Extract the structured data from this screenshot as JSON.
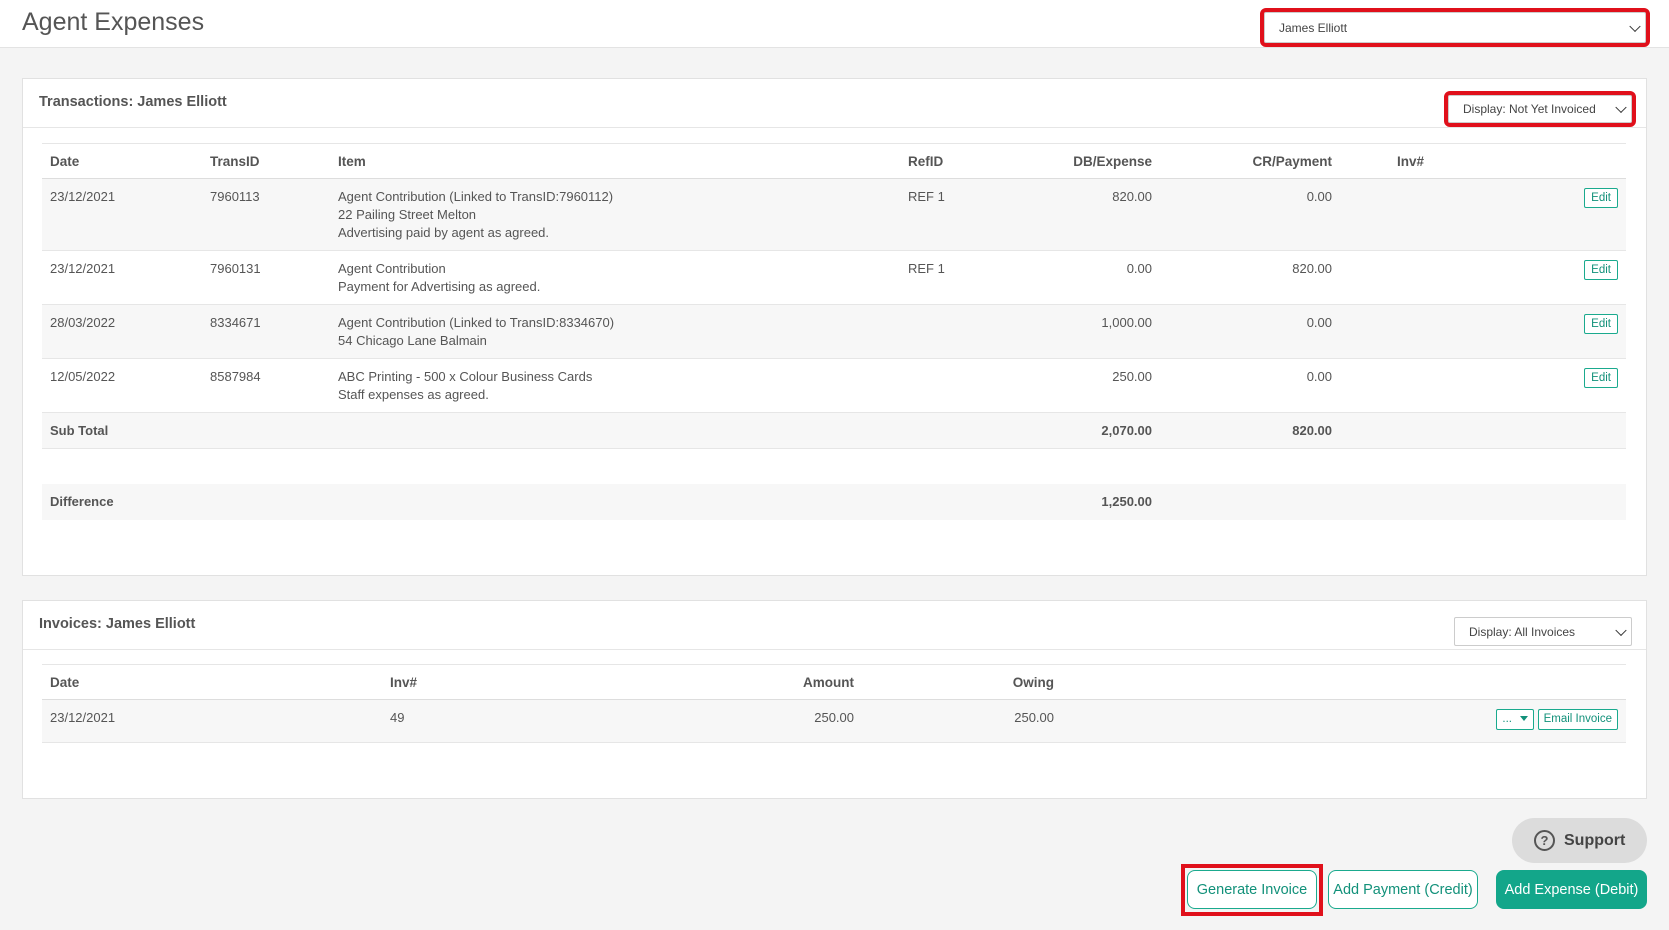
{
  "header": {
    "title": "Agent Expenses",
    "agent_select": "James Elliott"
  },
  "transactions": {
    "title": "Transactions: James Elliott",
    "filter": "Display: Not Yet Invoiced",
    "columns": [
      "Date",
      "TransID",
      "Item",
      "RefID",
      "DB/Expense",
      "CR/Payment",
      "Inv#"
    ],
    "rows": [
      {
        "date": "23/12/2021",
        "transid": "7960113",
        "item1": "Agent Contribution (Linked to TransID:7960112)",
        "item2": "22 Pailing Street Melton",
        "item3": "Advertising paid by agent as agreed.",
        "refid": "REF 1",
        "db": "820.00",
        "cr": "0.00",
        "edit": "Edit"
      },
      {
        "date": "23/12/2021",
        "transid": "7960131",
        "item1": "Agent Contribution",
        "item2": "Payment for Advertising as agreed.",
        "item3": "",
        "refid": "REF 1",
        "db": "0.00",
        "cr": "820.00",
        "edit": "Edit"
      },
      {
        "date": "28/03/2022",
        "transid": "8334671",
        "item1": "Agent Contribution (Linked to TransID:8334670)",
        "item2": "54 Chicago Lane Balmain",
        "item3": "",
        "refid": "",
        "db": "1,000.00",
        "cr": "0.00",
        "edit": "Edit"
      },
      {
        "date": "12/05/2022",
        "transid": "8587984",
        "item1": "ABC Printing - 500 x Colour Business Cards",
        "item2": "Staff expenses as agreed.",
        "item3": "",
        "refid": "",
        "db": "250.00",
        "cr": "0.00",
        "edit": "Edit"
      }
    ],
    "subtotal": {
      "label": "Sub Total",
      "db": "2,070.00",
      "cr": "820.00"
    },
    "difference": {
      "label": "Difference",
      "db": "1,250.00"
    }
  },
  "invoices": {
    "title": "Invoices: James Elliott",
    "filter": "Display: All Invoices",
    "columns": [
      "Date",
      "Inv#",
      "Amount",
      "Owing"
    ],
    "rows": [
      {
        "date": "23/12/2021",
        "inv": "49",
        "amount": "250.00",
        "owing": "250.00",
        "more": "...",
        "email": "Email Invoice"
      }
    ]
  },
  "support_label": "Support",
  "actions": {
    "generate": "Generate Invoice",
    "add_payment": "Add Payment (Credit)",
    "add_expense": "Add Expense (Debit)"
  },
  "colors": {
    "accent": "#13a68a",
    "highlight": "#e0101b"
  }
}
